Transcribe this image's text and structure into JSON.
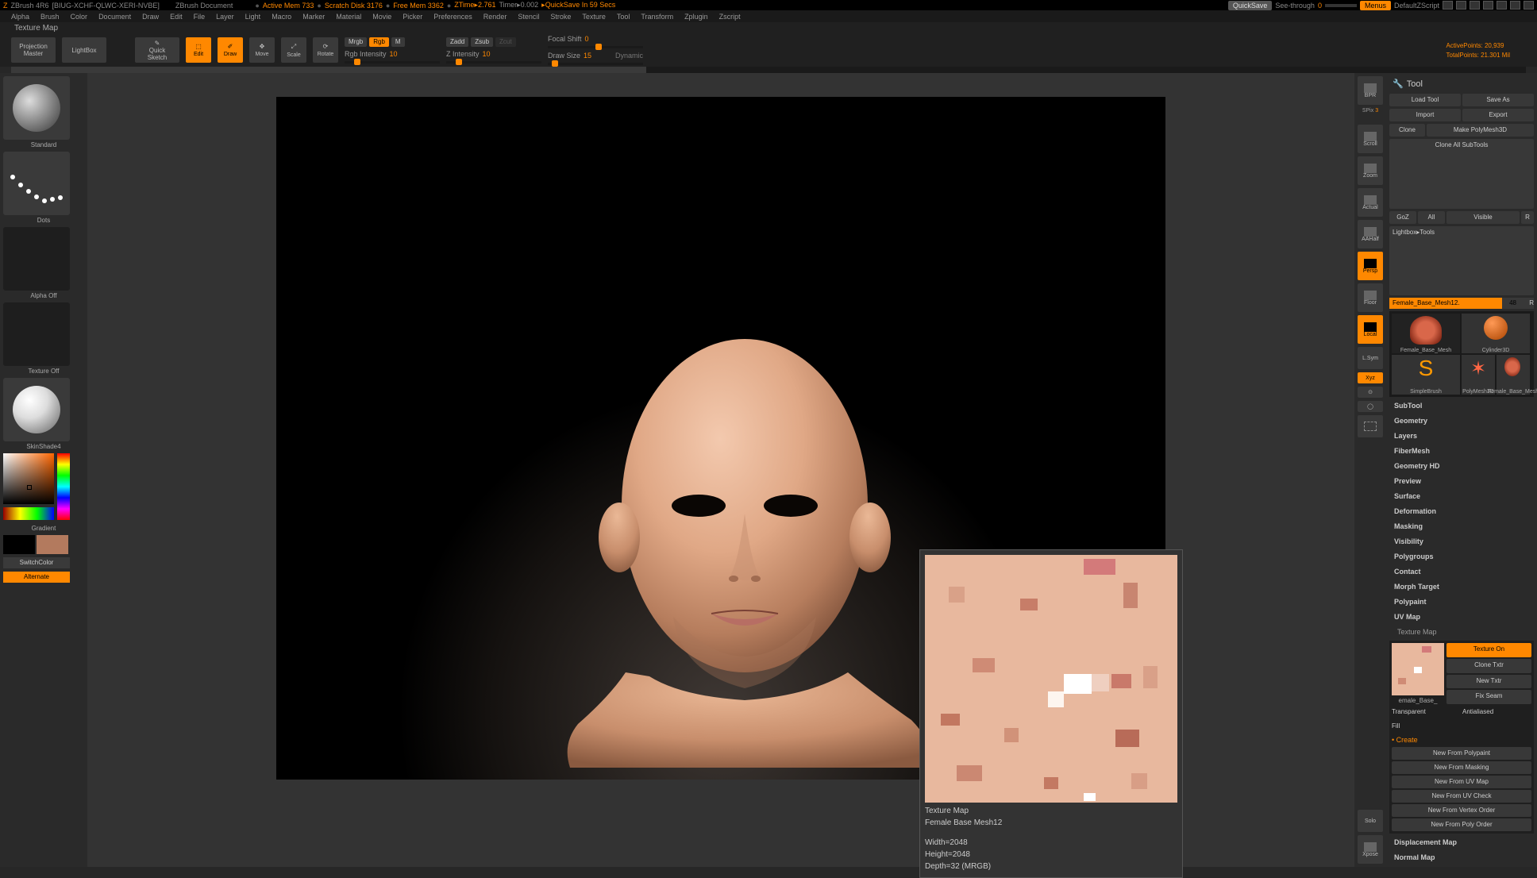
{
  "title": {
    "app": "ZBrush 4R6",
    "doc_id": "[BIUG-XCHF-QLWC-XERI-NVBE]",
    "doc_name": "ZBrush Document"
  },
  "status": {
    "mem": "Active Mem 733",
    "scratch": "Scratch Disk 3176",
    "free": "Free Mem 3362",
    "ztime": "ZTime▸2.761",
    "timer": "Timer▸0.002",
    "quicksave": "QuickSave In 59 Secs"
  },
  "top_btns": {
    "quicksave": "QuickSave",
    "seethru": "See-through",
    "seethru_val": "0",
    "menus": "Menus",
    "zscript": "DefaultZScript"
  },
  "menus": [
    "Alpha",
    "Brush",
    "Color",
    "Document",
    "Draw",
    "Edit",
    "File",
    "Layer",
    "Light",
    "Macro",
    "Marker",
    "Material",
    "Movie",
    "Picker",
    "Preferences",
    "Render",
    "Stencil",
    "Stroke",
    "Texture",
    "Tool",
    "Transform",
    "Zplugin",
    "Zscript"
  ],
  "subheader": "Texture Map",
  "toolbar": {
    "projection": "Projection\nMaster",
    "lightbox": "LightBox",
    "quicksketch": "Quick\nSketch",
    "edit": "Edit",
    "draw": "Draw",
    "move": "Move",
    "scale": "Scale",
    "rotate": "Rotate",
    "mrgb": "Mrgb",
    "rgb": "Rgb",
    "m": "M",
    "zadd": "Zadd",
    "zsub": "Zsub",
    "zcut": "Zcut",
    "rgbint_lbl": "Rgb Intensity",
    "rgbint_val": "10",
    "zint_lbl": "Z Intensity",
    "zint_val": "10",
    "focal_lbl": "Focal Shift",
    "focal_val": "0",
    "draw_lbl": "Draw Size",
    "draw_val": "15",
    "dynamic": "Dynamic",
    "active_pts": "ActivePoints: 20,939",
    "total_pts": "TotalPoints: 21.301 Mil"
  },
  "left": {
    "brush": "Standard",
    "stroke": "Dots",
    "alpha": "Alpha Off",
    "texture": "Texture Off",
    "material": "SkinShade4",
    "gradient": "Gradient",
    "switch": "SwitchColor",
    "alt": "Alternate"
  },
  "rtools": {
    "bpr": "BPR",
    "spix": "SPix",
    "spix_val": "3",
    "scroll": "Scroll",
    "zoom": "Zoom",
    "actual": "Actual",
    "aahalf": "AAHalf",
    "persp": "Persp",
    "floor": "Floor",
    "local": "Local",
    "lsym": "L.Sym",
    "xyz": "Xyz",
    "solo": "Solo",
    "xpose": "Xpose"
  },
  "tool": {
    "title": "Tool",
    "load": "Load Tool",
    "saveas": "Save As",
    "import": "Import",
    "export": "Export",
    "clone": "Clone",
    "makepoly": "Make PolyMesh3D",
    "cloneall": "Clone All SubTools",
    "goz": "GoZ",
    "all": "All",
    "visible": "Visible",
    "r": "R",
    "lightbox_tools": "Lightbox▸Tools",
    "toolname": "Female_Base_Mesh12.",
    "toolnum": "48",
    "items": [
      "Female_Base_Mesh",
      "Cylinder3D",
      "SimpleBrush",
      "PolyMesh3D",
      "Female_Base_Mesh"
    ]
  },
  "accordion": [
    "SubTool",
    "Geometry",
    "Layers",
    "FiberMesh",
    "Geometry HD",
    "Preview",
    "Surface",
    "Deformation",
    "Masking",
    "Visibility",
    "Polygroups",
    "Contact",
    "Morph Target",
    "Polypaint",
    "UV Map"
  ],
  "texmap": {
    "title": "Texture Map",
    "thumb_lbl": "emale_Base_",
    "texon": "Texture On",
    "clone": "Clone Txtr",
    "new": "New Txtr",
    "fixseam": "Fix Seam",
    "transparent": "Transparent",
    "antialiased": "Antialiased",
    "fill": "Fill",
    "create": "Create",
    "new_from": [
      "New From Polypaint",
      "New From Masking",
      "New From UV Map",
      "New From UV Check",
      "New From Vertex Order",
      "New From Poly Order"
    ]
  },
  "accordion2": [
    "Displacement Map",
    "Normal Map"
  ],
  "popup": {
    "line1": "Texture Map",
    "line2": "Female Base Mesh12",
    "line3": "Width=2048",
    "line4": "Height=2048",
    "line5": "Depth=32 (MRGB)"
  }
}
